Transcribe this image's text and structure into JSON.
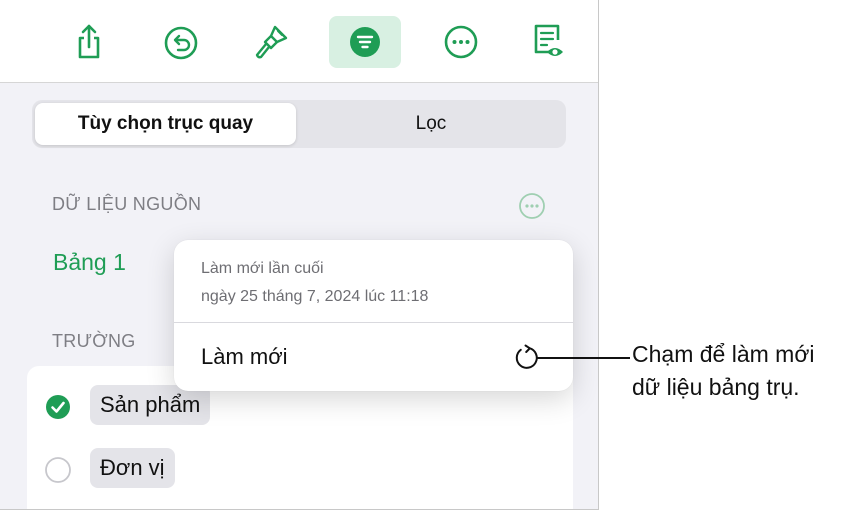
{
  "toolbar": {
    "items": [
      {
        "icon": "share-icon"
      },
      {
        "icon": "undo-icon"
      },
      {
        "icon": "format-brush-icon"
      },
      {
        "icon": "organize-icon",
        "active": true
      },
      {
        "icon": "more-icon"
      },
      {
        "icon": "reading-view-icon"
      }
    ],
    "accent_color": "#1f9d55",
    "active_bg": "#d8f0e2"
  },
  "segments": {
    "pivot_options": "Tùy chọn trục quay",
    "filter": "Lọc"
  },
  "source": {
    "title": "DỮ LIỆU NGUỒN",
    "table_name": "Bảng 1"
  },
  "fields": {
    "title": "TRƯỜNG",
    "items": [
      {
        "label": "Sản phẩm",
        "checked": true
      },
      {
        "label": "Đơn vị",
        "checked": false
      }
    ]
  },
  "popover": {
    "last_refresh_label": "Làm mới lần cuối",
    "last_refresh_date": "ngày 25 tháng 7, 2024 lúc 11:18",
    "refresh_label": "Làm mới"
  },
  "callout": {
    "line1": "Chạm để làm mới",
    "line2": "dữ liệu bảng trụ."
  }
}
